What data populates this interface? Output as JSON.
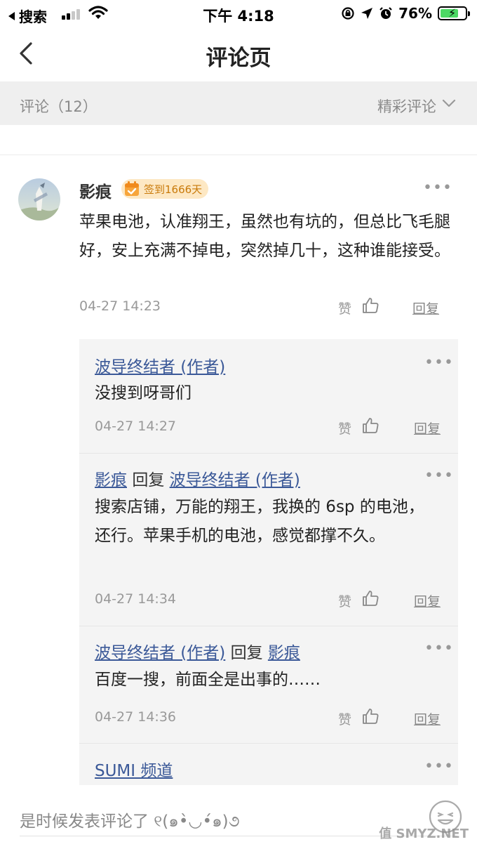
{
  "status_bar": {
    "back_app": "搜索",
    "time": "下午 4:18",
    "battery_percent": "76%",
    "battery_level": 0.76
  },
  "nav": {
    "title": "评论页"
  },
  "comments_header": {
    "count_label": "评论（12）",
    "sort_label": "精彩评论"
  },
  "comment": {
    "user": "影痕",
    "badge": "签到1666天",
    "text": "苹果电池，认准翔王，虽然也有坑的，但总比飞毛腿好，安上充满不掉电，突然掉几十，这种谁能接受。",
    "time": "04-27 14:23",
    "like_label": "赞",
    "reply_label": "回复"
  },
  "replies": [
    {
      "user": "波导终结者 (作者)",
      "reply_word": "",
      "reply_to": "",
      "text": "没搜到呀哥们",
      "time": "04-27 14:27",
      "like_label": "赞",
      "reply_label": "回复"
    },
    {
      "user": "影痕",
      "reply_word": "回复",
      "reply_to": "波导终结者 (作者)",
      "text": "搜索店铺，万能的翔王，我换的 6sp 的电池，还行。苹果手机的电池，感觉都撑不久。",
      "time": "04-27 14:34",
      "like_label": "赞",
      "reply_label": "回复"
    },
    {
      "user": "波导终结者 (作者)",
      "reply_word": "回复",
      "reply_to": "影痕",
      "text": "百度一搜，前面全是出事的……",
      "time": "04-27 14:36",
      "like_label": "赞",
      "reply_label": "回复"
    },
    {
      "user": "SUMI 频道",
      "reply_word": "",
      "reply_to": "",
      "text": "",
      "time": "",
      "like_label": "",
      "reply_label": ""
    }
  ],
  "input": {
    "placeholder": "是时候发表评论了 ୧(๑•̀◡•́๑)૭"
  },
  "watermark": "值 SMYZ.NET",
  "colors": {
    "link": "#3b5998",
    "badge_bg": "#fde8c4",
    "badge_text": "#c97a0a",
    "battery": "#4cd964"
  }
}
